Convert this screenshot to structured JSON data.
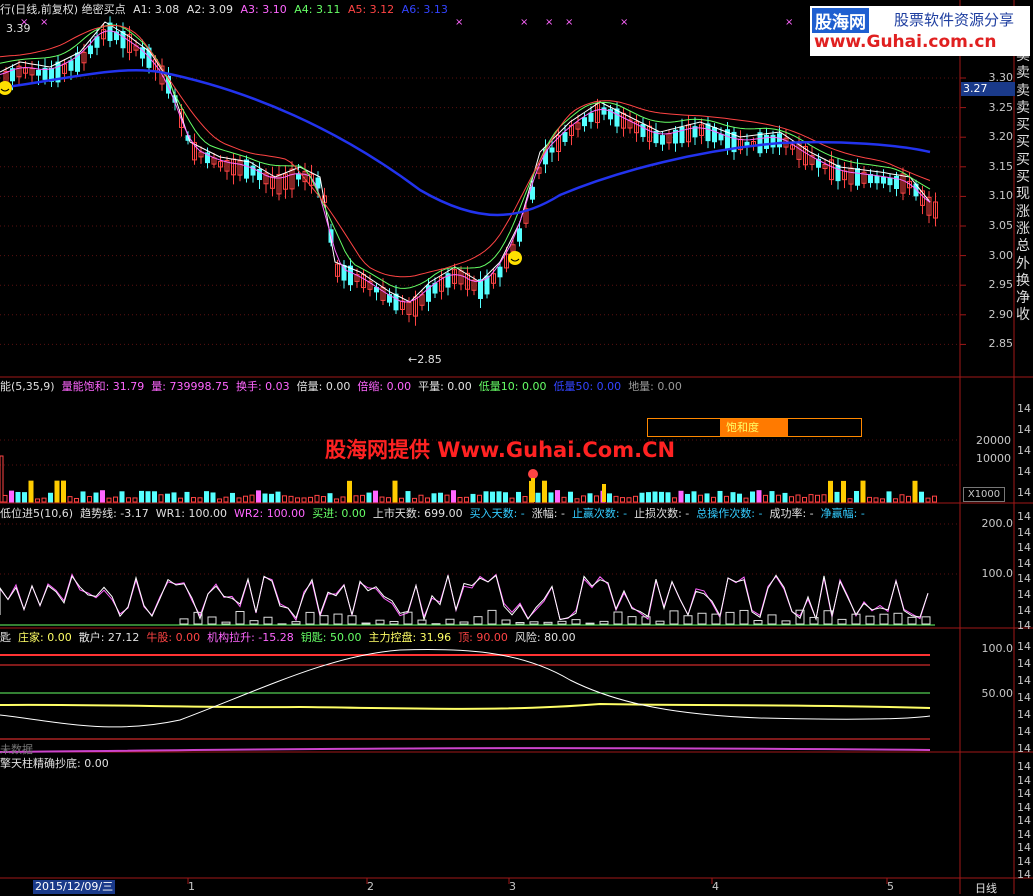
{
  "main": {
    "title": "行(日线,前复权) 绝密买点",
    "a1": "A1: 3.08",
    "a2": "A2: 3.09",
    "a3": "A3: 3.10",
    "a4": "A4: 3.11",
    "a5": "A5: 3.12",
    "a6": "A6: 3.13",
    "high_label": "3.39",
    "low_label": "←2.85",
    "price_ticks": [
      "3.30",
      "3.25",
      "3.20",
      "3.15",
      "3.10",
      "3.05",
      "3.00",
      "2.95",
      "2.90",
      "2.85"
    ],
    "current_price": "3.27",
    "side_words": [
      "卖",
      "卖",
      "卖",
      "卖",
      "买",
      "买",
      "买",
      "买",
      "现",
      "涨",
      "涨",
      "总",
      "外",
      "换",
      "净",
      "收"
    ]
  },
  "logo": {
    "name": "股海网",
    "slogan": "股票软件资源分享",
    "url": "www.Guhai.com.cn"
  },
  "volume": {
    "header": [
      {
        "text": "能(5,35,9)",
        "color": "#e0e0e0"
      },
      {
        "text": "量能饱和: 31.79",
        "color": "#ff66ff"
      },
      {
        "text": "量: 739998.75",
        "color": "#ff66ff"
      },
      {
        "text": "换手: 0.03",
        "color": "#ff66ff"
      },
      {
        "text": "倍量: 0.00",
        "color": "#e0e0e0"
      },
      {
        "text": "倍缩: 0.00",
        "color": "#ff66ff"
      },
      {
        "text": "平量: 0.00",
        "color": "#e0e0e0"
      },
      {
        "text": "低量10: 0.00",
        "color": "#66ff66"
      },
      {
        "text": "低量50: 0.00",
        "color": "#3344ff"
      },
      {
        "text": "地量: 0.00",
        "color": "#999999"
      }
    ],
    "saturation_label": "饱和度",
    "watermark": "股海网提供 Www.Guhai.Com.CN",
    "ticks": [
      "20000",
      "10000"
    ],
    "unit": "X1000"
  },
  "trend": {
    "header": [
      {
        "text": "低位进5(10,6)",
        "color": "#e0e0e0"
      },
      {
        "text": "趋势线: -3.17",
        "color": "#e0e0e0"
      },
      {
        "text": "WR1: 100.00",
        "color": "#e0e0e0"
      },
      {
        "text": "WR2: 100.00",
        "color": "#ff66ff"
      },
      {
        "text": "买进: 0.00",
        "color": "#66ff66"
      },
      {
        "text": "上市天数: 699.00",
        "color": "#e0e0e0"
      },
      {
        "text": "买入天数: -",
        "color": "#33ccff"
      },
      {
        "text": "涨幅: -",
        "color": "#e0e0e0"
      },
      {
        "text": "止赢次数: -",
        "color": "#33ccff"
      },
      {
        "text": "止损次数: -",
        "color": "#e0e0e0"
      },
      {
        "text": "总操作次数: -",
        "color": "#33ccff"
      },
      {
        "text": "成功率: -",
        "color": "#e0e0e0"
      },
      {
        "text": "净赢幅: -",
        "color": "#33ccff"
      }
    ],
    "ticks": [
      "200.0",
      "100.0"
    ]
  },
  "control": {
    "header": [
      {
        "text": "匙",
        "color": "#e0e0e0"
      },
      {
        "text": "庄家: 0.00",
        "color": "#ffff66"
      },
      {
        "text": "散户: 27.12",
        "color": "#e0e0e0"
      },
      {
        "text": "牛股: 0.00",
        "color": "#ff4444"
      },
      {
        "text": "机构拉升: -15.28",
        "color": "#ff66ff"
      },
      {
        "text": "钥匙: 50.00",
        "color": "#66ff66"
      },
      {
        "text": "主力控盘: 31.96",
        "color": "#ffff66"
      },
      {
        "text": "顶: 90.00",
        "color": "#ff4444"
      },
      {
        "text": "风险: 80.00",
        "color": "#e0e0e0"
      }
    ],
    "ticks": [
      "100.0",
      "50.00"
    ],
    "no_data": "未数据"
  },
  "bottom": {
    "header": "擎天柱精确抄底: 0.00",
    "right_digits": [
      "14",
      "14",
      "14",
      "14",
      "14",
      "14",
      "14",
      "14",
      "14"
    ]
  },
  "timeline": {
    "date": "2015/12/09/三",
    "months": [
      "1",
      "2",
      "3",
      "4",
      "5"
    ],
    "period": "日线"
  },
  "right_digits_vol": [
    "14",
    "14",
    "14",
    "14",
    "14"
  ],
  "right_digits_trend": [
    "14",
    "14",
    "14",
    "14",
    "14",
    "14",
    "14",
    "14"
  ],
  "right_digits_ctrl": [
    "14",
    "14",
    "14",
    "14",
    "14",
    "14",
    "14"
  ]
}
